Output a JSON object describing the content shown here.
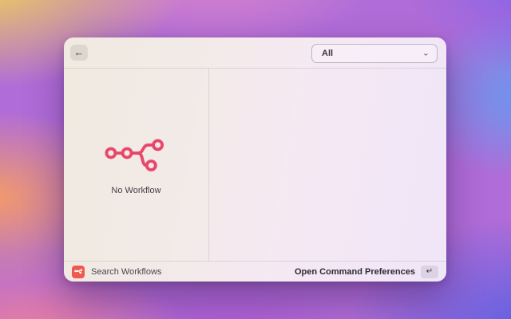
{
  "colors": {
    "accent": "#e8476b",
    "app_icon_bg": "#ef5a50",
    "window_text": "#3f3b40"
  },
  "window": {
    "header": {
      "icons": {
        "back": "←",
        "chevron_down": "⌄"
      },
      "filter_dropdown": {
        "value": "All"
      }
    },
    "left_panel": {
      "empty_state": {
        "icon": "workflow-graph",
        "label": "No Workflow"
      }
    },
    "footer": {
      "app_icon": "workflow-graph",
      "command_name": "Search Workflows",
      "primary_action": {
        "label": "Open Command Preferences",
        "key_icon": "↵"
      }
    }
  }
}
